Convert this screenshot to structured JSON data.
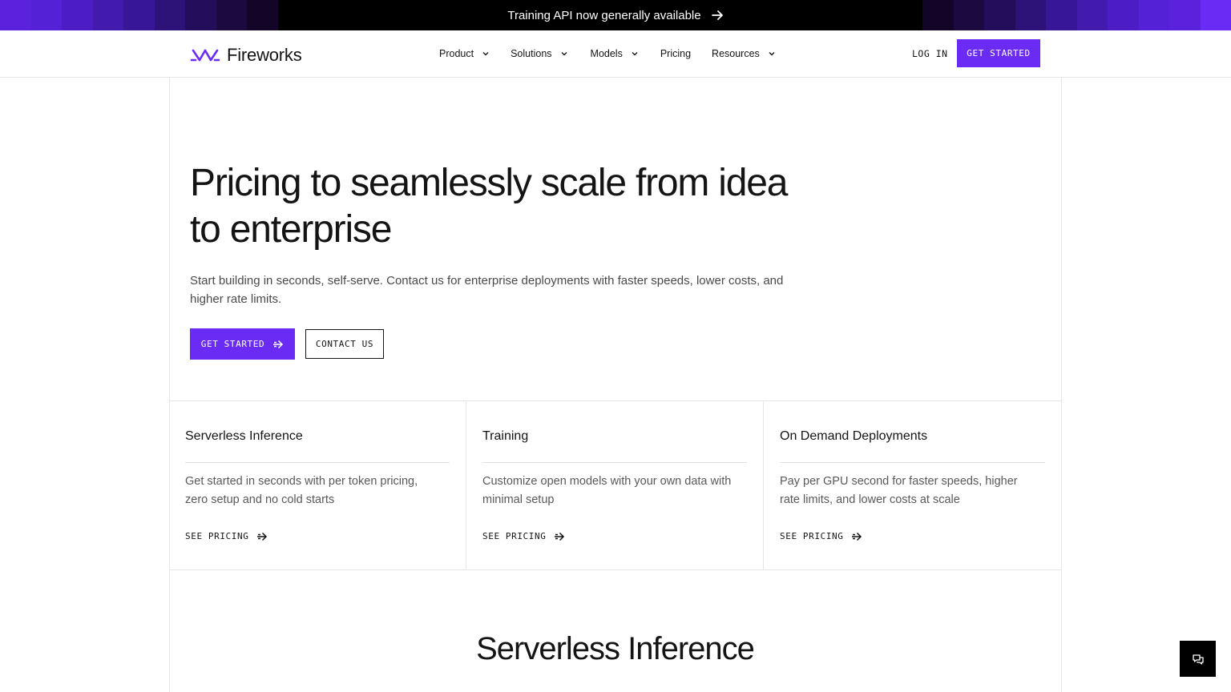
{
  "banner": {
    "text": "Training API now generally available",
    "left_tiles": [
      "#5a22dd",
      "#5521d6",
      "#4c1dc4",
      "#421aad",
      "#381796",
      "#2d1278",
      "#220e5a",
      "#1a0a40",
      "#120528"
    ],
    "right_tiles": [
      "#120528",
      "#1a0a40",
      "#220e5a",
      "#2d1278",
      "#381796",
      "#421aad",
      "#4c1dc4",
      "#5521d6",
      "#5a22dd",
      "#6a2cf5"
    ]
  },
  "header": {
    "logo_text": "Fireworks",
    "nav": [
      {
        "label": "Product",
        "has_dropdown": true
      },
      {
        "label": "Solutions",
        "has_dropdown": true
      },
      {
        "label": "Models",
        "has_dropdown": true
      },
      {
        "label": "Pricing",
        "has_dropdown": false
      },
      {
        "label": "Resources",
        "has_dropdown": true
      }
    ],
    "login_label": "LOG IN",
    "cta_label": "GET STARTED"
  },
  "hero": {
    "title": "Pricing to seamlessly scale from idea to enterprise",
    "subtitle": "Start building in seconds, self-serve. Contact us for enterprise deployments with faster speeds, lower costs, and higher rate limits.",
    "primary_label": "GET STARTED",
    "secondary_label": "CONTACT US"
  },
  "cards": [
    {
      "title": "Serverless Inference",
      "description": "Get started in seconds with per token pricing, zero setup and no cold starts",
      "link_label": "SEE PRICING"
    },
    {
      "title": "Training",
      "description": "Customize open models with your own data with minimal setup",
      "link_label": "SEE PRICING"
    },
    {
      "title": "On Demand Deployments",
      "description": "Pay per GPU second for faster speeds, higher rate limits, and lower costs at scale",
      "link_label": "SEE PRICING"
    }
  ],
  "section": {
    "title": "Serverless Inference"
  },
  "colors": {
    "accent": "#6a2cf5",
    "text": "#141414",
    "muted": "#595959",
    "border": "#e6e6e6"
  }
}
